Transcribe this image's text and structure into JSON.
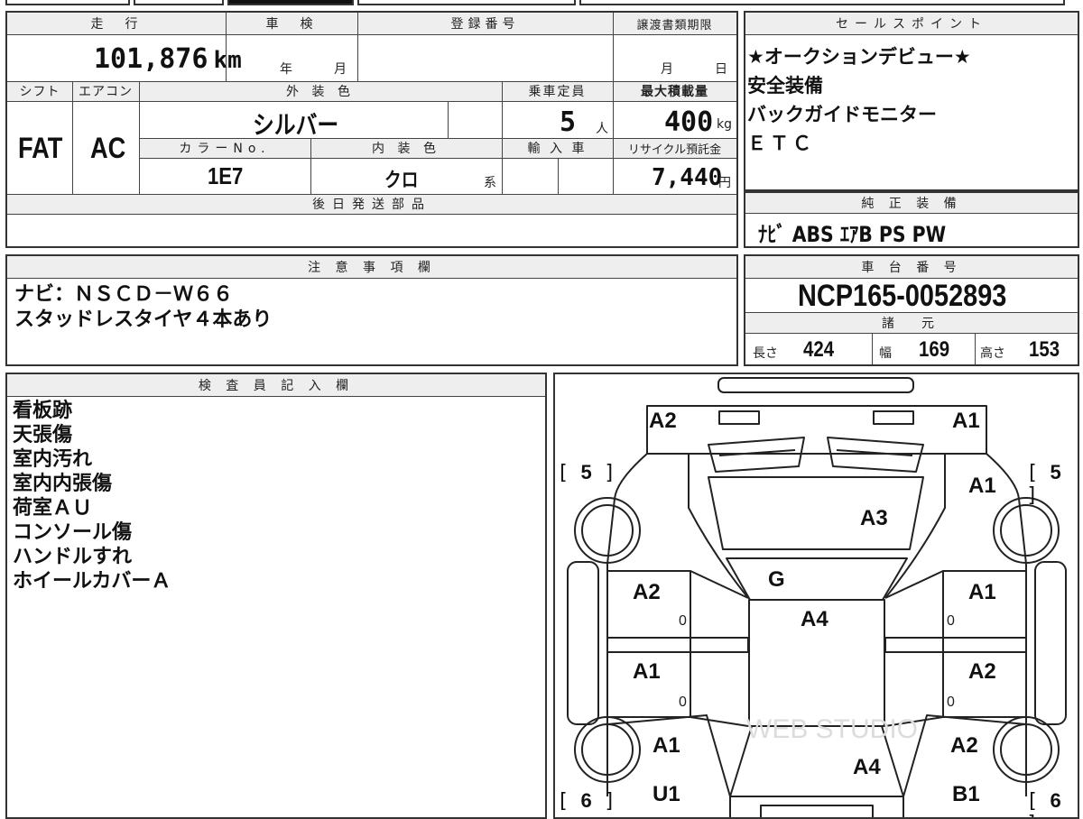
{
  "vehicle": {
    "mileage": {
      "label": "走　行",
      "value": "101,876",
      "unit": "km"
    },
    "inspection": {
      "label": "車　検",
      "year_unit": "年",
      "month_unit": "月"
    },
    "registration": {
      "label": "登録番号",
      "value": ""
    },
    "transfer_deadline": {
      "label": "譲渡書類期限",
      "month_unit": "月",
      "day_unit": "日"
    },
    "shift": {
      "label": "シフト",
      "value": "FAT"
    },
    "aircon": {
      "label": "エアコン",
      "value": "AC"
    },
    "exterior_color": {
      "label": "外 装 色",
      "value": "シルバー"
    },
    "capacity": {
      "label": "乗車定員",
      "value": "5",
      "unit": "人"
    },
    "max_load": {
      "label": "最大積載量",
      "value": "400",
      "unit": "kg"
    },
    "color_no": {
      "label": "カラーNo.",
      "value": "1E7"
    },
    "interior_color": {
      "label": "内 装 色",
      "value": "クロ",
      "suffix": "系"
    },
    "import": {
      "label": "輸 入 車",
      "value": ""
    },
    "recycle_fee": {
      "label": "リサイクル預託金",
      "value": "7,440",
      "unit": "円"
    },
    "later_parts": {
      "label": "後日発送部品",
      "value": ""
    }
  },
  "sales_points": {
    "label": "セールスポイント",
    "lines": [
      "★オークションデビュー★",
      "安全装備",
      "バックガイドモニター",
      "ＥＴＣ"
    ]
  },
  "equipment": {
    "label": "純 正 装 備",
    "value": "ﾅﾋﾞ ABS ｴｱB PS PW"
  },
  "notes": {
    "label": "注 意 事 項 欄",
    "lines": [
      "ナビ：ＮＳＣＤ－Ｗ６６",
      "スタッドレスタイヤ４本あり"
    ]
  },
  "chassis": {
    "label": "車 台 番 号",
    "value": "NCP165-0052893"
  },
  "specs": {
    "label": "諸　元",
    "length": {
      "label": "長さ",
      "value": "424"
    },
    "width": {
      "label": "幅",
      "value": "169"
    },
    "height": {
      "label": "高さ",
      "value": "153"
    }
  },
  "inspector": {
    "label": "検 査 員 記 入 欄",
    "lines": [
      "看板跡",
      "天張傷",
      "室内汚れ",
      "室内内張傷",
      "荷室ＡＵ",
      "コンソール傷",
      "ハンドルすれ",
      "ホイールカバーＡ"
    ]
  },
  "diagram": {
    "tread": {
      "front_left": "5",
      "front_right": "5",
      "rear_left": "6",
      "rear_right": "6"
    },
    "marks": {
      "front_left": "A2",
      "front_right": "A1",
      "hood": "A3",
      "right_front_fender": "A1",
      "windshield": "G",
      "roof": "A4",
      "left_front_door": "A2",
      "right_front_door": "A1",
      "left_rear_door": "A1",
      "right_rear_door": "A2",
      "left_quarter": "A1",
      "right_quarter": "A2",
      "rear_glass": "A4",
      "left_rear_bumper": "U1",
      "right_rear_bumper": "B1"
    },
    "zero_mark": "0",
    "watermark": "WEB STUDIO"
  }
}
